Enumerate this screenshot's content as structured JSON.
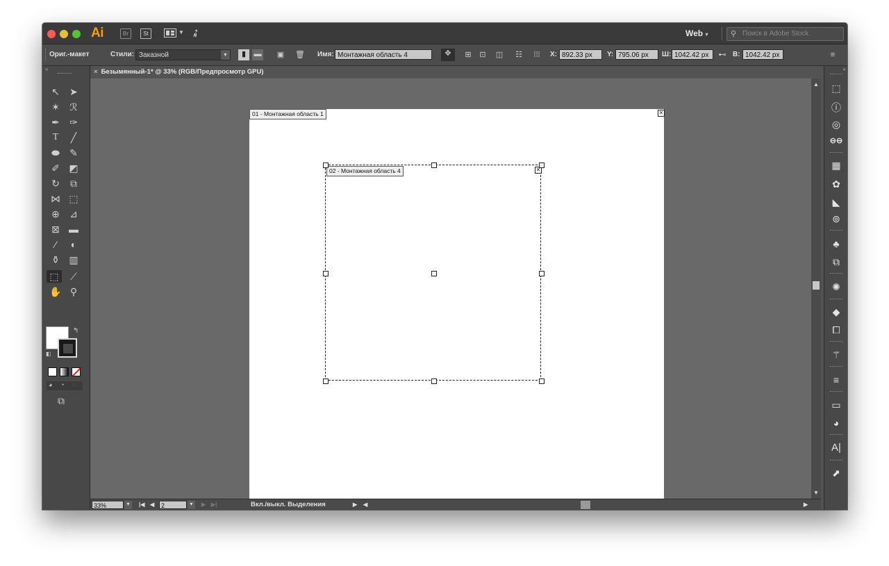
{
  "app": {
    "logo": "Ai",
    "bridge_label": "Br",
    "stock_label": "St",
    "workspace": "Web",
    "search_placeholder": "Поиск в Adobe Stock"
  },
  "controlbar": {
    "preset_label": "Ориг.-макет",
    "styles_label": "Стили:",
    "styles_value": "Заказной",
    "name_label": "Имя:",
    "name_value": "Монтажная область 4",
    "x_label": "X:",
    "x_value": "892.33 px",
    "y_label": "Y:",
    "y_value": "795.06 px",
    "w_label": "Ш:",
    "w_value": "1042.42 px",
    "h_label": "В:",
    "h_value": "1042.42 px"
  },
  "document": {
    "tab_title": "Безымянный-1* @ 33% (RGB/Предпросмотр GPU)",
    "artboard1_label": "01 - Монтажная область 1",
    "artboard2_label": "02 - Монтажная область 4"
  },
  "statusbar": {
    "zoom": "33%",
    "artboard_index": "2",
    "status_text": "Вкл./выкл. Выделения"
  }
}
